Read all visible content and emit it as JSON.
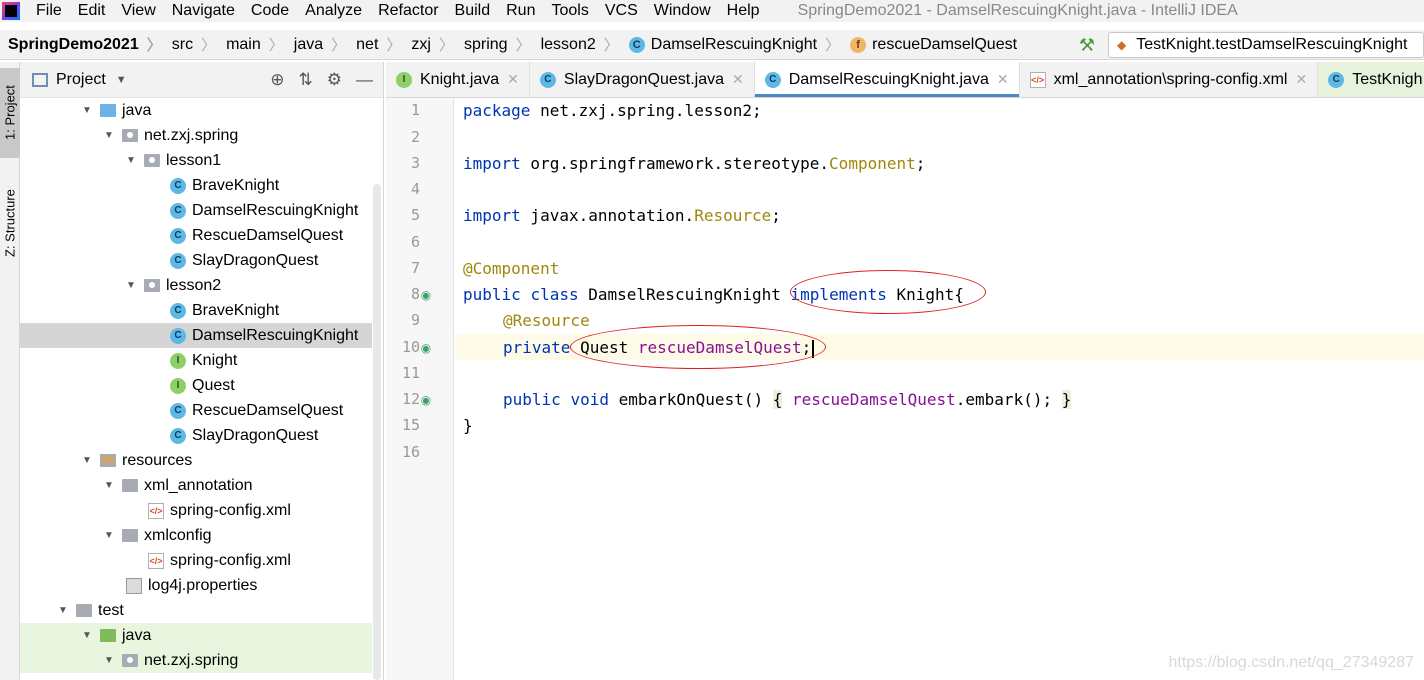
{
  "menu": {
    "items": [
      "File",
      "Edit",
      "View",
      "Navigate",
      "Code",
      "Analyze",
      "Refactor",
      "Build",
      "Run",
      "Tools",
      "VCS",
      "Window",
      "Help"
    ],
    "window_title": "SpringDemo2021 - DamselRescuingKnight.java - IntelliJ IDEA"
  },
  "breadcrumbs": [
    "SpringDemo2021",
    "src",
    "main",
    "java",
    "net",
    "zxj",
    "spring",
    "lesson2",
    "DamselRescuingKnight",
    "rescueDamselQuest"
  ],
  "run_config": "TestKnight.testDamselRescuingKnight",
  "tool_windows": {
    "project": "1: Project",
    "structure": "Z: Structure"
  },
  "project_panel": {
    "title": "Project",
    "tree": [
      {
        "label": "java",
        "icon": "folder-blue"
      },
      {
        "label": "net.zxj.spring",
        "icon": "package"
      },
      {
        "label": "lesson1",
        "icon": "package"
      },
      {
        "label": "BraveKnight",
        "icon": "class"
      },
      {
        "label": "DamselRescuingKnight",
        "icon": "class"
      },
      {
        "label": "RescueDamselQuest",
        "icon": "class"
      },
      {
        "label": "SlayDragonQuest",
        "icon": "class"
      },
      {
        "label": "lesson2",
        "icon": "package"
      },
      {
        "label": "BraveKnight",
        "icon": "class"
      },
      {
        "label": "DamselRescuingKnight",
        "icon": "class"
      },
      {
        "label": "Knight",
        "icon": "interface"
      },
      {
        "label": "Quest",
        "icon": "interface"
      },
      {
        "label": "RescueDamselQuest",
        "icon": "class"
      },
      {
        "label": "SlayDragonQuest",
        "icon": "class"
      },
      {
        "label": "resources",
        "icon": "resources-folder"
      },
      {
        "label": "xml_annotation",
        "icon": "folder-gray"
      },
      {
        "label": "spring-config.xml",
        "icon": "xml"
      },
      {
        "label": "xmlconfig",
        "icon": "folder-gray"
      },
      {
        "label": "spring-config.xml",
        "icon": "xml"
      },
      {
        "label": "log4j.properties",
        "icon": "properties"
      },
      {
        "label": "test",
        "icon": "folder-gray"
      },
      {
        "label": "java",
        "icon": "folder-green"
      },
      {
        "label": "net.zxj.spring",
        "icon": "package"
      }
    ]
  },
  "editor_tabs": [
    {
      "label": "Knight.java",
      "icon": "interface"
    },
    {
      "label": "SlayDragonQuest.java",
      "icon": "class"
    },
    {
      "label": "DamselRescuingKnight.java",
      "icon": "class"
    },
    {
      "label": "xml_annotation\\spring-config.xml",
      "icon": "xml"
    },
    {
      "label": "TestKnigh",
      "icon": "test-class"
    }
  ],
  "line_numbers": [
    "1",
    "2",
    "3",
    "4",
    "5",
    "6",
    "7",
    "8",
    "9",
    "10",
    "11",
    "12",
    "15",
    "16"
  ],
  "code": {
    "l1_kw": "package",
    "l1_rest": " net.zxj.spring.lesson2;",
    "l3_kw": "import",
    "l3_rest": " org.springframework.stereotype.",
    "l3_type": "Component",
    "l3_end": ";",
    "l5_kw": "import",
    "l5_rest": " javax.annotation.",
    "l5_type": "Resource",
    "l5_end": ";",
    "l7_ann": "@Component",
    "l8_kw1": "public",
    "l8_kw2": "class",
    "l8_name": " DamselRescuingKnight ",
    "l8_kw3": "implements",
    "l8_rest": " Knight{",
    "l9_ann": "@Resource",
    "l10_kw": "private",
    "l10_type": " Quest ",
    "l10_field": "rescueDamselQuest",
    "l10_end": ";",
    "l12_kw1": "public",
    "l12_kw2": "void",
    "l12_name": " embarkOnQuest() ",
    "l12_open": "{",
    "l12_field": " rescueDamselQuest",
    "l12_call": ".embark(); ",
    "l12_close": "}",
    "l13": "}"
  },
  "watermark": "https://blog.csdn.net/qq_27349287"
}
